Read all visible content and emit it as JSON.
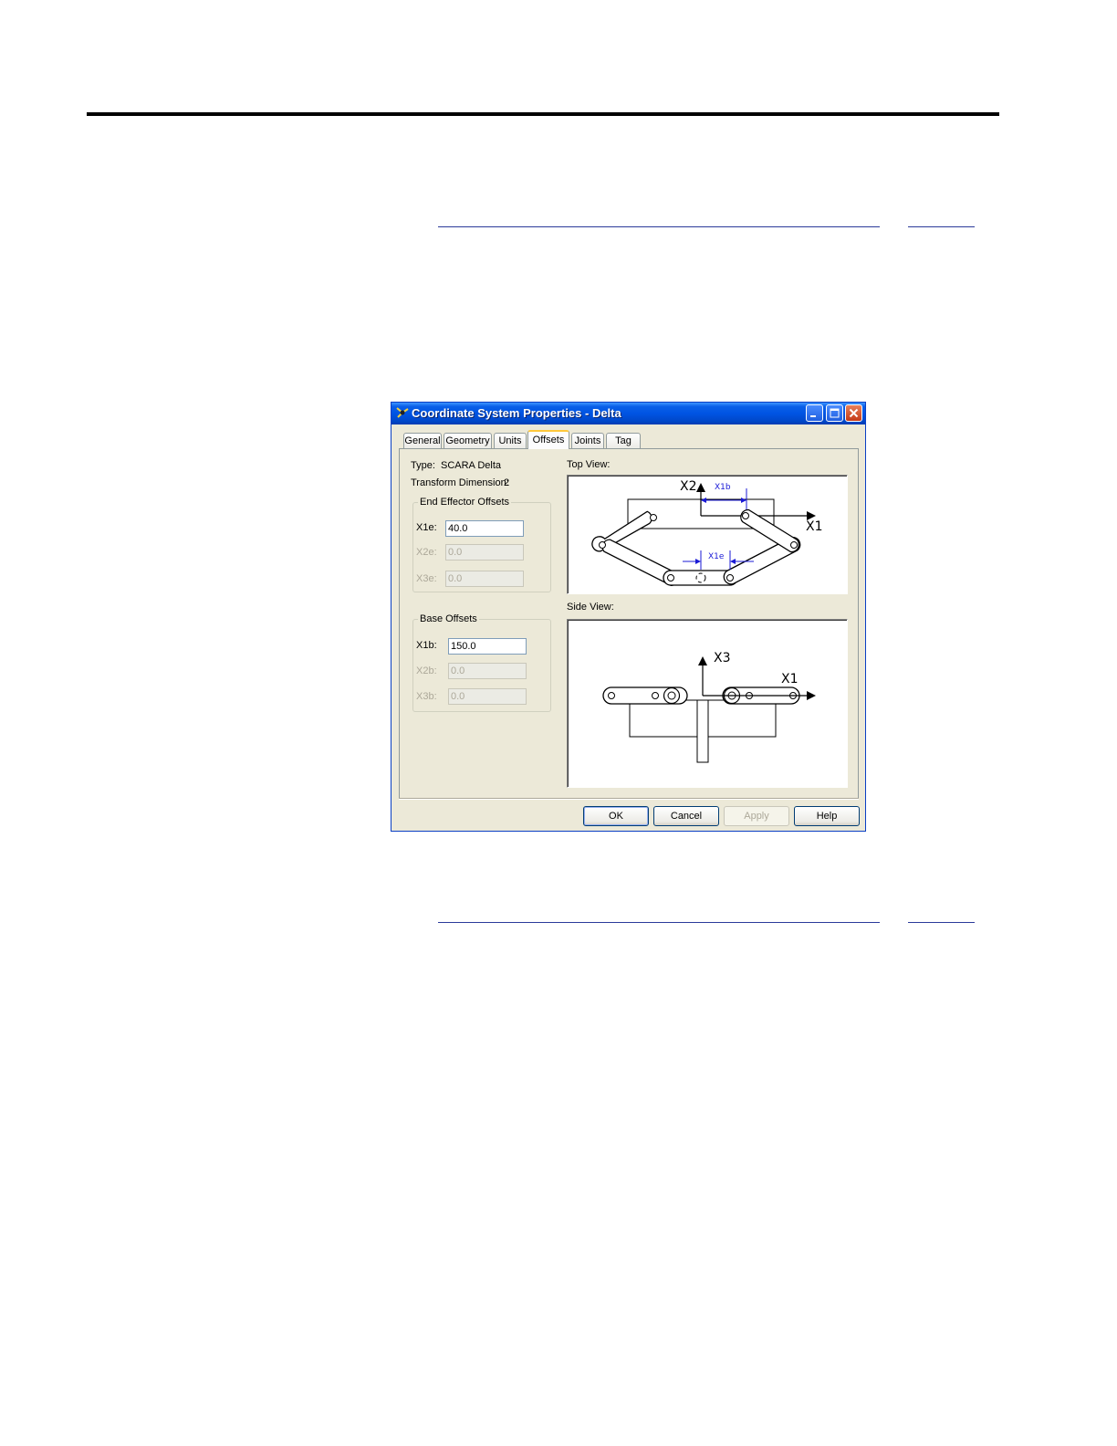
{
  "dialog": {
    "title": "Coordinate System Properties - Delta",
    "tabs": [
      {
        "label": "General",
        "active": false
      },
      {
        "label": "Geometry",
        "active": false
      },
      {
        "label": "Units",
        "active": false
      },
      {
        "label": "Offsets",
        "active": true
      },
      {
        "label": "Joints",
        "active": false
      },
      {
        "label": "Tag",
        "active": false
      }
    ],
    "type_label": "Type:",
    "type_value": "SCARA Delta",
    "transform_label": "Transform Dimension:",
    "transform_value": "2",
    "end_effector": {
      "legend": "End Effector Offsets",
      "fields": [
        {
          "label": "X1e:",
          "value": "40.0",
          "enabled": true
        },
        {
          "label": "X2e:",
          "value": "0.0",
          "enabled": false
        },
        {
          "label": "X3e:",
          "value": "0.0",
          "enabled": false
        }
      ]
    },
    "base_offsets": {
      "legend": "Base Offsets",
      "fields": [
        {
          "label": "X1b:",
          "value": "150.0",
          "enabled": true
        },
        {
          "label": "X2b:",
          "value": "0.0",
          "enabled": false
        },
        {
          "label": "X3b:",
          "value": "0.0",
          "enabled": false
        }
      ]
    },
    "top_view": {
      "label": "Top View:",
      "x1": "X1",
      "x2": "X2",
      "x1b": "X1b",
      "x1e": "X1e"
    },
    "side_view": {
      "label": "Side View:",
      "x1": "X1",
      "x3": "X3"
    },
    "buttons": {
      "ok": "OK",
      "cancel": "Cancel",
      "apply": "Apply",
      "help": "Help"
    },
    "colors": {
      "titlebar": "#0054e3",
      "dimension": "#1a1ad6",
      "face": "#ece9d8"
    }
  }
}
